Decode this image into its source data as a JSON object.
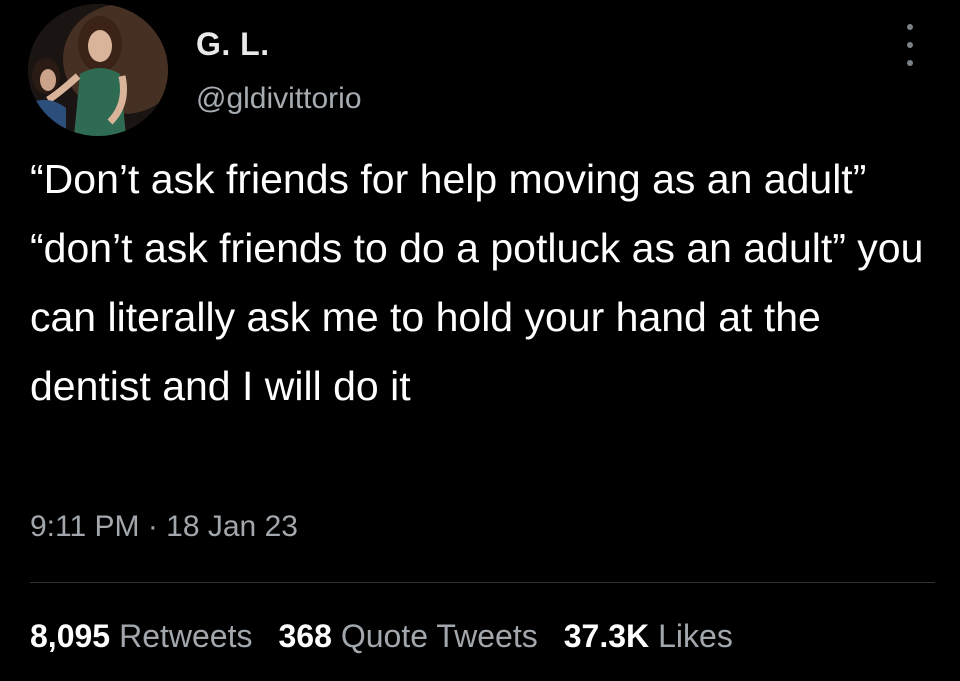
{
  "author": {
    "display_name": "G. L.",
    "handle": "@gldivittorio"
  },
  "tweet": {
    "text": "“Don’t ask friends for help moving as an adult” “don’t ask friends to do a potluck as an adult” you can literally ask me to hold your hand at the dentist and I will do it",
    "timestamp": "9:11 PM · 18 Jan 23"
  },
  "stats": {
    "retweets_count": "8,095",
    "retweets_label": "Retweets",
    "quote_tweets_count": "368",
    "quote_tweets_label": "Quote Tweets",
    "likes_count": "37.3K",
    "likes_label": "Likes"
  },
  "icons": {
    "more": "more-options-icon"
  },
  "colors": {
    "background": "#000000",
    "primary_text": "#ffffff",
    "secondary_text": "#a1a7ac",
    "divider": "#2f3336"
  }
}
